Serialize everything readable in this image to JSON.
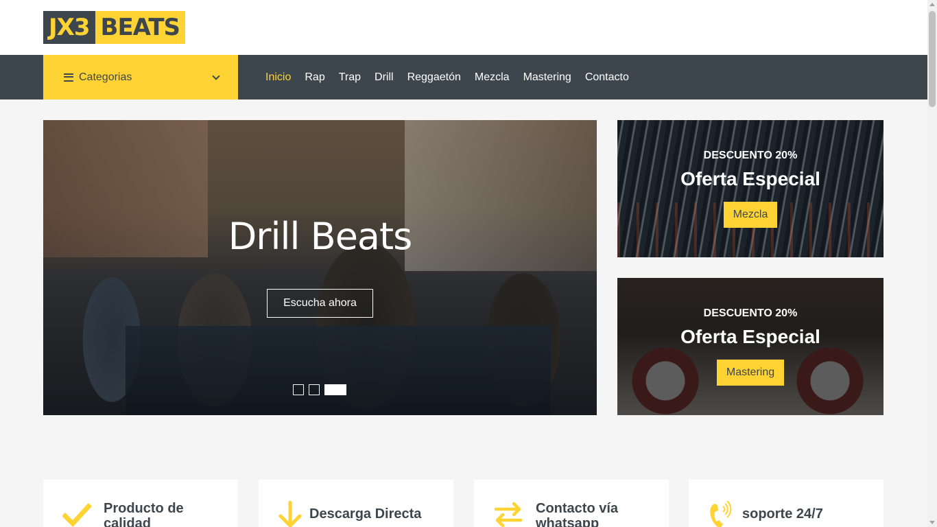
{
  "brand": {
    "logo_left": "JX3",
    "logo_right": "BEATS"
  },
  "colors": {
    "accent": "#ffd333",
    "dark": "#3d464d",
    "background": "#f5f5f5"
  },
  "navbar": {
    "categories_label": "Categorias",
    "menu": [
      {
        "label": "Inicio",
        "active": true
      },
      {
        "label": "Rap"
      },
      {
        "label": "Trap"
      },
      {
        "label": "Drill"
      },
      {
        "label": "Reggaetón"
      },
      {
        "label": "Mezcla"
      },
      {
        "label": "Mastering"
      },
      {
        "label": "Contacto"
      }
    ]
  },
  "hero": {
    "title": "Drill Beats",
    "button_label": "Escucha ahora",
    "slide_count": 3,
    "active_slide": 3
  },
  "offers": [
    {
      "discount": "DESCUENTO 20%",
      "title": "Oferta Especial",
      "button_label": "Mezcla"
    },
    {
      "discount": "DESCUENTO 20%",
      "title": "Oferta Especial",
      "button_label": "Mastering"
    }
  ],
  "features": [
    {
      "icon": "check-icon",
      "text": "Producto de calidad"
    },
    {
      "icon": "arrow-down-icon",
      "text": "Descarga Directa"
    },
    {
      "icon": "exchange-arrows-icon",
      "text": "Contacto vía whatsapp"
    },
    {
      "icon": "phone-volume-icon",
      "text": "soporte 24/7"
    }
  ]
}
